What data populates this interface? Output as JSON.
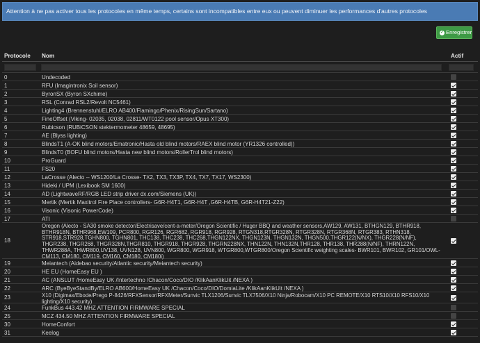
{
  "banner": {
    "text": "Attention à ne pas activer tous les protocoles en même temps, certains sont incompatibles entre eux ou peuvent diminuer les performances d'autres protocoles"
  },
  "toolbar": {
    "save_label": "Enregistrer"
  },
  "table": {
    "headers": {
      "id": "Protocole",
      "name": "Nom",
      "active": "Actif"
    },
    "rows": [
      {
        "id": "0",
        "name": "Undecoded",
        "active": false
      },
      {
        "id": "1",
        "name": "RFU (Imagintronix Soil sensor)",
        "active": true
      },
      {
        "id": "2",
        "name": "ByronSX (Byron SXchime)",
        "active": true
      },
      {
        "id": "3",
        "name": "RSL (Conrad RSL2/Revolt NC5461)",
        "active": true
      },
      {
        "id": "4",
        "name": "Lighting4 (Brennenstuhl/ELRO AB400/Flamingo/Phenix/RisingSun/Sartano)",
        "active": true
      },
      {
        "id": "5",
        "name": "FineOffset (Viking- 02035, 02038, 02811/WT0122 pool sensor/Opus XT300)",
        "active": true
      },
      {
        "id": "6",
        "name": "Rubicson (RUBiCSON stektermometer 48659, 48695)",
        "active": true
      },
      {
        "id": "7",
        "name": "AE (Blyss lighting)",
        "active": true
      },
      {
        "id": "8",
        "name": "BlindsT1 (A-OK blind motors/Ematronic/Hasta old blind motors/RAEX blind motor (YR1326 controlled))",
        "active": true
      },
      {
        "id": "9",
        "name": "BlindsT0 (BOFU blind motors/Hasta new blind motors/RollerTrol blind motors)",
        "active": true
      },
      {
        "id": "10",
        "name": "ProGuard",
        "active": true
      },
      {
        "id": "11",
        "name": "FS20",
        "active": true
      },
      {
        "id": "12",
        "name": "LaCrosse (Alecto -- WS1200/La Crosse- TX2, TX3, TX3P, TX4, TX7, TX17, WS2300)",
        "active": true
      },
      {
        "id": "13",
        "name": "Hideki / UPM (Lexibook SM 1600)",
        "active": true
      },
      {
        "id": "14",
        "name": "AD (LightwaveRF/RGB LED strip driver dx.com/Siemens (UK))",
        "active": true
      },
      {
        "id": "15",
        "name": "Mertik (Mertik Maxitrol Fire Place controllers- G6R-H4T1, G6R-H4T ,G6R-H4TB, G6R-H4T21-Z22)",
        "active": true
      },
      {
        "id": "16",
        "name": "Visonic (Visonic PowerCode)",
        "active": true
      },
      {
        "id": "17",
        "name": "ATI",
        "active": false
      },
      {
        "id": "18",
        "name": "Oregon (Alecto - SA30 smoke detector/Electrisave/cent-a-meter/Oregon Scientific / Huger BBQ and weather sensors,AW129, AW131, BTHGN129, BTHR918, BTHR918N, BTHR968,EW109, PCR800, RGR126, RGR682, RGR918, RGR928, RTGN318,RTGR328N, RTGR328N, RTGR368N, RTGR383, RTHN318, STR918,STR928,TGHN800, TGHN801, THC138, THC238, THC268,THGN122NX, THGN123N, THGN132N, THGN500,THGR122(N/NX), THGR228(N/NF), THGR238, THGR268, THGR328N,THGR810, THGR918, THGR928, THGRN228NX, THN122N, THN132N,THR128, THR138, THR288(N/NF), THRN122N, THWR288A, THWR800,UV138, UVN128, UVN800, WGR800, WGR918, WTGR800,WTGR800/Oregon Scientific weighting scales- BWR101, BWR102, GR101/OWL- CM113, CM180, CM119, CM160, CM180, CM180i)",
        "active": true
      },
      {
        "id": "19",
        "name": "Meiantech (Aidebao security/Atlantic security/Meiantech security)",
        "active": true
      },
      {
        "id": "20",
        "name": "HE EU (HomeEasy EU )",
        "active": true
      },
      {
        "id": "21",
        "name": "AC (ANSLUT /HomeEasy UK /Intertechno /Chacon/Coco/DIO /KlikAanKlikUit /NEXA )",
        "active": true
      },
      {
        "id": "22",
        "name": "ARC (ByeByeStandBy/ELRO AB600/HomeEasy UK /Chacon/Coco/DIO/DomiaLite /KlikAanKlikUit /NEXA )",
        "active": true
      },
      {
        "id": "23",
        "name": "X10 (Digimax/Ebode/Prego P-8426/RFXSensor/RFXMeter/Sunvic TLX1206/Sunvic TLX7506/X10 Ninja/Robocam/X10 PC REMOTE/X10 RTS10/X10 RFS10/X10 lighting/X10 security)",
        "active": true
      },
      {
        "id": "24",
        "name": "FunkBus 443.42 MHZ ATTENTION FIRMWARE SPECIAL",
        "active": false
      },
      {
        "id": "25",
        "name": "MCZ 434.50 MHZ ATTENTION FIRMWARE SPECIAL",
        "active": false
      },
      {
        "id": "30",
        "name": "HomeConfort",
        "active": true
      },
      {
        "id": "31",
        "name": "Keelog",
        "active": true
      }
    ]
  }
}
